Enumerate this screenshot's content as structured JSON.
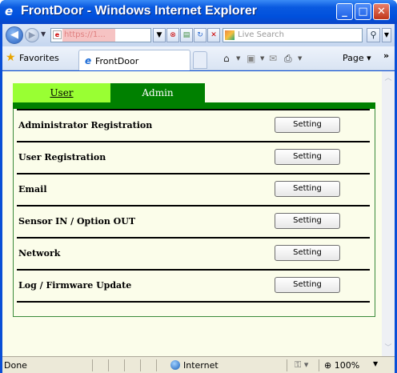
{
  "window": {
    "title": "FrontDoor - Windows Internet Explorer",
    "icon": "ie-logo-icon"
  },
  "navbar": {
    "address_text": "https://1...",
    "search_placeholder": "Live Search"
  },
  "favorites_bar": {
    "favorites_label": "Favorites",
    "tab_label": "FrontDoor",
    "page_menu_label": "Page"
  },
  "page": {
    "tabs": [
      {
        "label": "User",
        "active": false,
        "color": "#99ff33"
      },
      {
        "label": "Admin",
        "active": true,
        "color": "#008000"
      }
    ],
    "rows": [
      {
        "label": "Administrator Registration",
        "button_label": "Setting"
      },
      {
        "label": "User Registration",
        "button_label": "Setting"
      },
      {
        "label": "Email",
        "button_label": "Setting"
      },
      {
        "label": "Sensor IN / Option OUT",
        "button_label": "Setting"
      },
      {
        "label": "Network",
        "button_label": "Setting"
      },
      {
        "label": "Log / Firmware Update",
        "button_label": "Setting"
      }
    ]
  },
  "statusbar": {
    "status": "Done",
    "zone": "Internet",
    "zoom": "100%"
  },
  "colors": {
    "content_background": "#fbfdea",
    "accent_green": "#008000",
    "inactive_tab": "#99ff33"
  }
}
